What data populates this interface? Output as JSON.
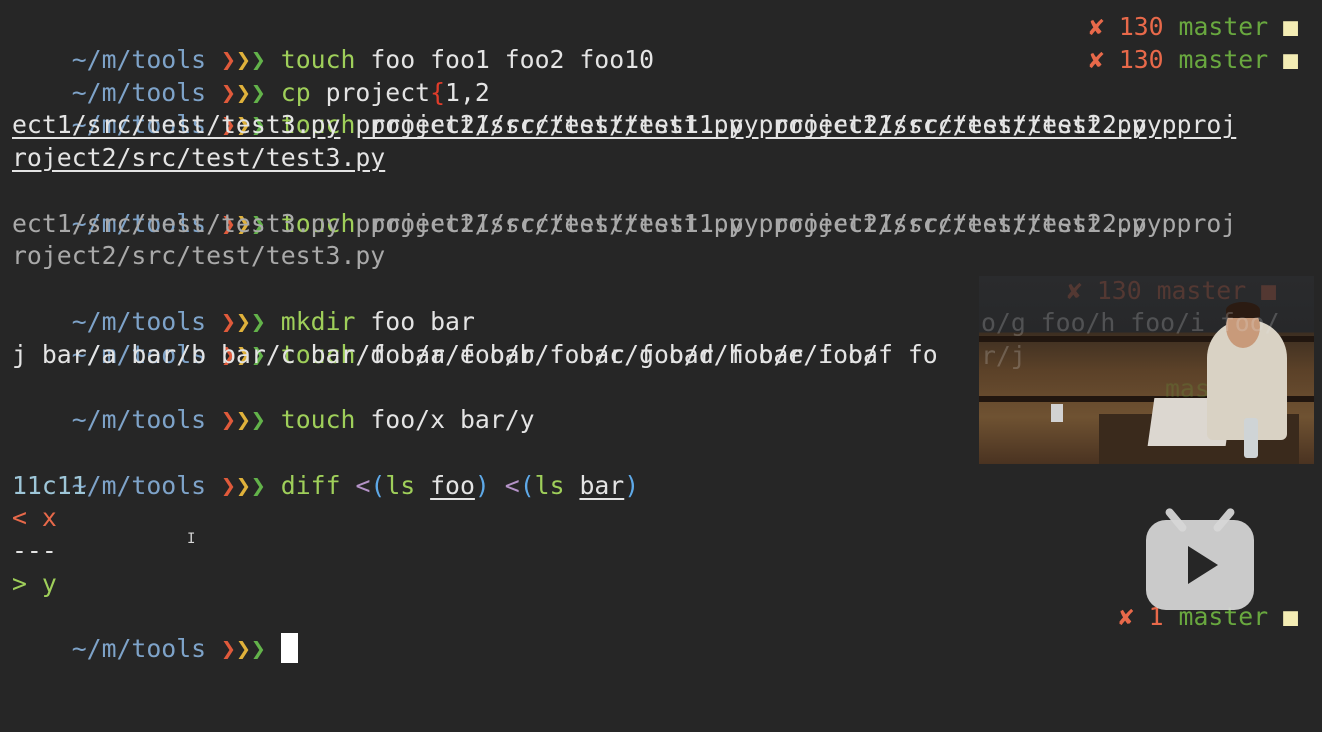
{
  "prompt": {
    "path": "~/m/tools",
    "arrows": [
      "❯",
      "❯",
      "❯"
    ]
  },
  "right_prompts": {
    "line1": {
      "x": "✘",
      "code": "130",
      "branch": "master",
      "square": "■"
    },
    "line2": {
      "x": "✘",
      "code": "130",
      "branch": "master",
      "square": "■"
    },
    "last": {
      "x": "✘",
      "code": "1",
      "branch": "master",
      "square": "■"
    }
  },
  "lines": {
    "l1": {
      "cmd": "touch",
      "args": "foo foo1 foo2 foo10"
    },
    "l2": {
      "cmd": "cp",
      "arg1": "project",
      "brace": "{",
      "arg2": "1,2"
    },
    "l3": {
      "cmd": "touch",
      "args": [
        "project1/src/test/test1.py",
        "project1/src/test/test2.py",
        "proj"
      ]
    },
    "l4": {
      "args": [
        "ect1/src/test/test3.py",
        "project2/src/test/test1.py",
        "project2/src/test/test2.py",
        "p"
      ]
    },
    "l5": {
      "args": [
        "roject2/src/test/test3.py"
      ]
    },
    "l6": {
      "cmd": "touch",
      "text": "project1/src/test/test1.py project1/src/test/test2.py proj"
    },
    "l7": {
      "text": "ect1/src/test/test3.py project2/src/test/test1.py project2/src/test/test2.py p"
    },
    "l8": {
      "text": "roject2/src/test/test3.py"
    },
    "l9": {
      "cmd": "mkdir",
      "args": "foo bar"
    },
    "l10": {
      "cmd": "touch",
      "args": "foo/a foo/b foo/c foo/d foo/e foo/f fo"
    },
    "l11": {
      "text": "j bar/a bar/b bar/c bar/d bar/e bar/f bar/g bar/h bar/i ba"
    },
    "l12": {
      "cmd": "touch",
      "args": "foo/x bar/y"
    },
    "l14": {
      "cmd": "diff",
      "lt1": "<",
      "p1o": "(",
      "ls1": "ls",
      "a1": "foo",
      "p1c": ")",
      "lt2": "<",
      "p2o": "(",
      "ls2": "ls",
      "a2": "bar",
      "p2c": ")"
    },
    "l15": {
      "text": "11c11"
    },
    "l16": {
      "text": "< x"
    },
    "l17": {
      "text": "---"
    },
    "l18": {
      "text": "> y"
    }
  },
  "overlay": {
    "ghost_right_prompt": "✘ 130 master ■",
    "ghost_line10": "o/g foo/h foo/i foo/",
    "ghost_line11": "r/j",
    "ghost_master": "mas"
  },
  "colors": {
    "background": "#262626",
    "path": "#7ea3c9",
    "command": "#9fcf5a",
    "error": "#e8694a"
  },
  "icons": {
    "play_button": "bilibili-play-icon",
    "cursor": "text-ibeam-icon"
  }
}
